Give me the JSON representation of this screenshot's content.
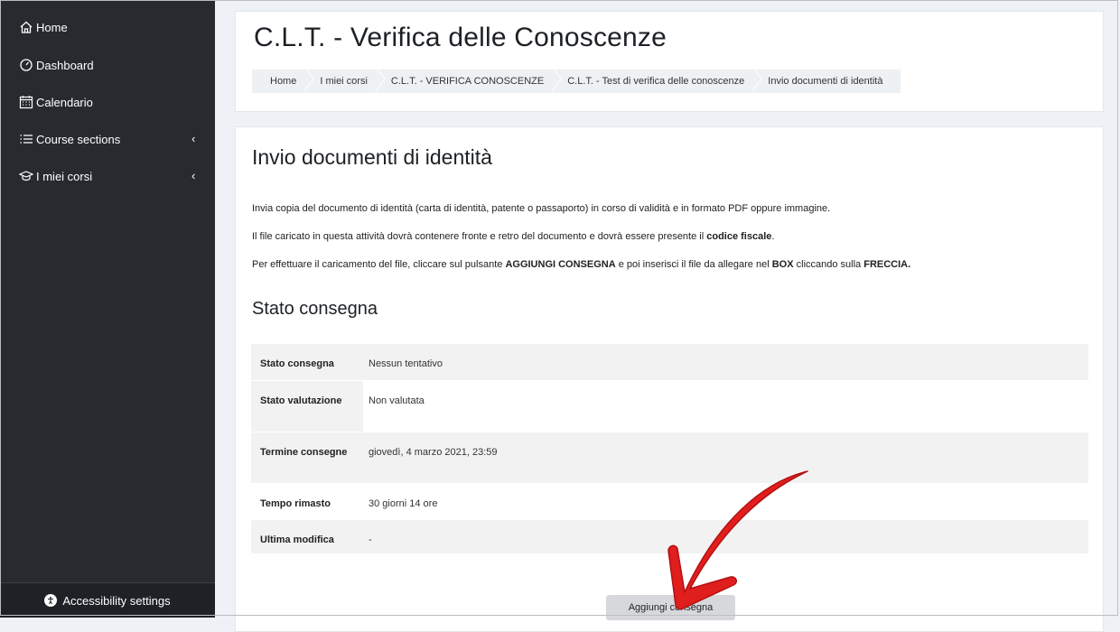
{
  "sidebar": {
    "items": [
      {
        "label": "Home",
        "icon": "home-icon"
      },
      {
        "label": "Dashboard",
        "icon": "gauge-icon"
      },
      {
        "label": "Calendario",
        "icon": "calendar-icon"
      },
      {
        "label": "Course sections",
        "icon": "list-icon",
        "chevron": "‹"
      },
      {
        "label": "I miei corsi",
        "icon": "graduation-cap-icon",
        "chevron": "‹"
      }
    ],
    "accessibility_label": "Accessibility settings"
  },
  "header": {
    "title": "C.L.T. - Verifica delle Conoscenze",
    "breadcrumb": [
      "Home",
      "I miei corsi",
      "C.L.T. - VERIFICA CONOSCENZE",
      "C.L.T. - Test di verifica delle conoscenze",
      "Invio documenti di identità"
    ]
  },
  "main": {
    "title": "Invio documenti di identità",
    "para1": "Invia copia del documento di identità (carta di identità, patente o passaporto) in corso di validità e in formato PDF oppure immagine.",
    "para2_text": "Il file caricato in questa attività dovrà contenere fronte e retro del documento e dovrà essere presente il ",
    "para2_bold": "codice fiscale",
    "para2_end": ".",
    "para3_a": "Per effettuare il caricamento del file, cliccare sul pulsante ",
    "para3_b": "AGGIUNGI CONSEGNA",
    "para3_c": " e poi inserisci il file da allegare nel ",
    "para3_d": "BOX",
    "para3_e": " cliccando sulla ",
    "para3_f": "FRECCIA.",
    "status_title": "Stato consegna",
    "status_rows": [
      {
        "label": "Stato consegna",
        "value": "Nessun tentativo"
      },
      {
        "label": "Stato valutazione",
        "value": "Non valutata"
      },
      {
        "label": "Termine consegne",
        "value": "giovedì, 4 marzo 2021, 23:59"
      },
      {
        "label": "Tempo rimasto",
        "value": "30 giorni 14 ore"
      },
      {
        "label": "Ultima modifica",
        "value": "-"
      }
    ],
    "add_button": "Aggiungi consegna"
  },
  "colors": {
    "sidebar_bg": "#272b30",
    "arrow": "#e01e1e"
  }
}
